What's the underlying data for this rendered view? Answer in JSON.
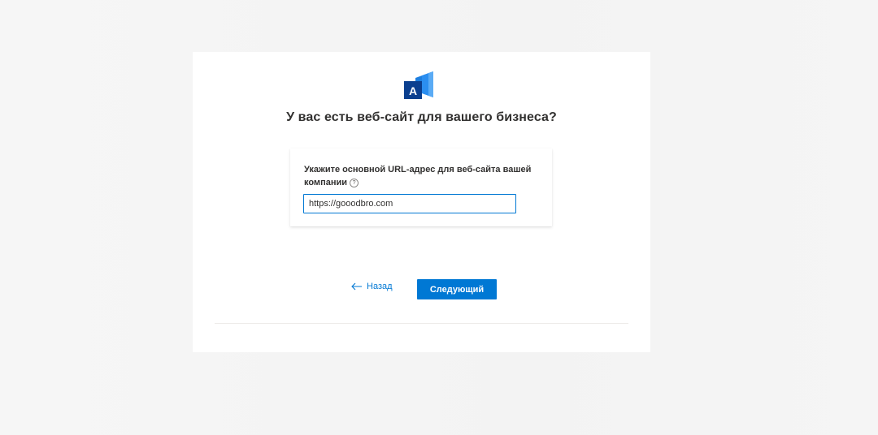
{
  "dialog": {
    "title": "У вас есть веб-сайт для вашего бизнеса?",
    "logo_letter": "A"
  },
  "url_card": {
    "label": "Укажите основной URL-адрес для веб-сайта вашей компании",
    "help_glyph": "?",
    "input_value": "https://gooodbro.com"
  },
  "actions": {
    "back_label": "Назад",
    "next_label": "Следующий"
  },
  "colors": {
    "accent": "#0078d4",
    "text": "#323130",
    "logo_dark": "#0b3f8f",
    "logo_light": "#1e7fe0"
  }
}
